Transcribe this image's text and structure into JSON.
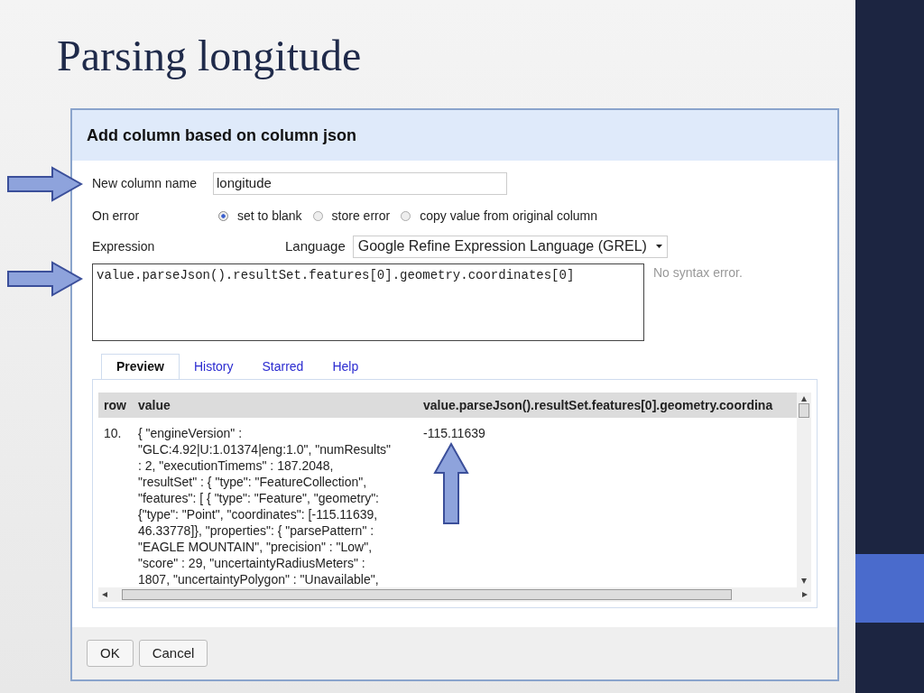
{
  "slide": {
    "title": "Parsing longitude"
  },
  "dialog": {
    "title": "Add column based on column json",
    "column_name": {
      "label": "New column name",
      "value": "longitude"
    },
    "on_error": {
      "label": "On error",
      "options": [
        {
          "label": "set to blank",
          "selected": true
        },
        {
          "label": "store error",
          "selected": false
        },
        {
          "label": "copy value from original column",
          "selected": false
        }
      ]
    },
    "expression": {
      "label": "Expression",
      "language_label": "Language",
      "language": "Google Refine Expression Language (GREL)",
      "value": "value.parseJson().resultSet.features[0].geometry.coordinates[0]",
      "status": "No syntax error."
    },
    "tabs": [
      {
        "label": "Preview",
        "selected": true
      },
      {
        "label": "History",
        "selected": false
      },
      {
        "label": "Starred",
        "selected": false
      },
      {
        "label": "Help",
        "selected": false
      }
    ],
    "preview": {
      "columns": [
        "row",
        "value",
        "value.parseJson().resultSet.features[0].geometry.coordina"
      ],
      "rows": [
        {
          "row": "10.",
          "value": "{ \"engineVersion\" : \"GLC:4.92|U:1.01374|eng:1.0\", \"numResults\" : 2, \"executionTimems\" : 187.2048, \"resultSet\" : { \"type\": \"FeatureCollection\", \"features\": [ { \"type\": \"Feature\", \"geometry\": {\"type\": \"Point\", \"coordinates\": [-115.11639, 46.33778]}, \"properties\": { \"parsePattern\" : \"EAGLE MOUNTAIN\", \"precision\" : \"Low\", \"score\" : 29, \"uncertaintyRadiusMeters\" : 1807, \"uncertaintyPolygon\" : \"Unavailable\",",
          "result": "-115.11639"
        }
      ]
    },
    "buttons": [
      "OK",
      "Cancel"
    ]
  }
}
